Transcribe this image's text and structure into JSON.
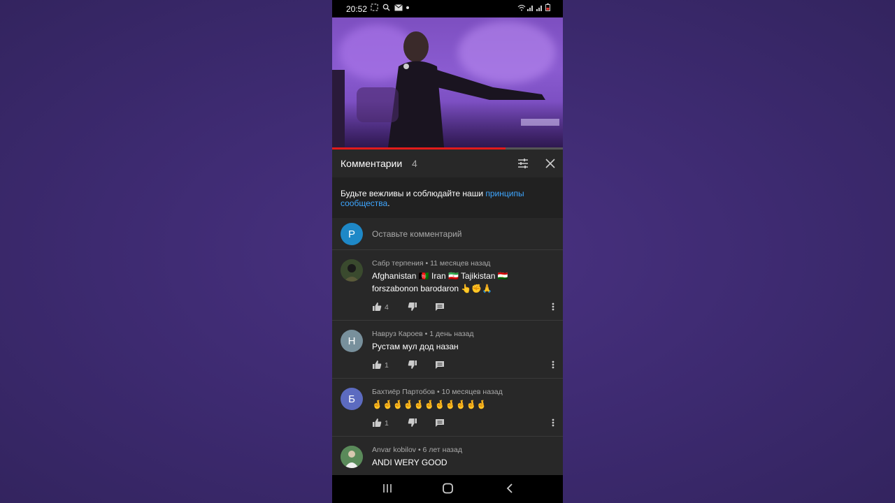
{
  "status_bar": {
    "time": "20:52"
  },
  "comments_panel": {
    "title": "Комментарии",
    "count": "4",
    "guidelines_text": "Будьте вежливы и соблюдайте наши ",
    "guidelines_link": "принципы сообщества",
    "guidelines_end": ".",
    "add_comment": {
      "avatar_letter": "P",
      "placeholder": "Оставьте комментарий"
    }
  },
  "video": {
    "progress_percent": 75
  },
  "comments": [
    {
      "author": "Сабр терпения",
      "time": "11 месяцев назад",
      "text": "Afghanistan 🇦🇫 Iran 🇮🇷 Tajikistan 🇹🇯 forszabonon barodaron 👆✊🙏",
      "likes": "4",
      "avatar_letter": ""
    },
    {
      "author": "Навруз Кароев",
      "time": "1 день назад",
      "text": "Рустам мул дод назан",
      "likes": "1",
      "avatar_letter": "Н"
    },
    {
      "author": "Бахтиёр Партобов",
      "time": "10 месяцев назад",
      "text": "🤞🤞🤞🤞🤞🤞🤞🤞🤞🤞🤞",
      "likes": "1",
      "avatar_letter": "Б"
    },
    {
      "author": "Anvar kobilov",
      "time": "6 лет назад",
      "text": "ANDI WERY GOOD",
      "likes": "",
      "avatar_letter": ""
    }
  ],
  "meta_separator": " • ",
  "colors": {
    "accent_link": "#3ea6ff",
    "avatar_p": "#1e88c7",
    "avatar_n": "#78909c",
    "avatar_b": "#5c6bc0",
    "progress": "#e21b1b"
  }
}
